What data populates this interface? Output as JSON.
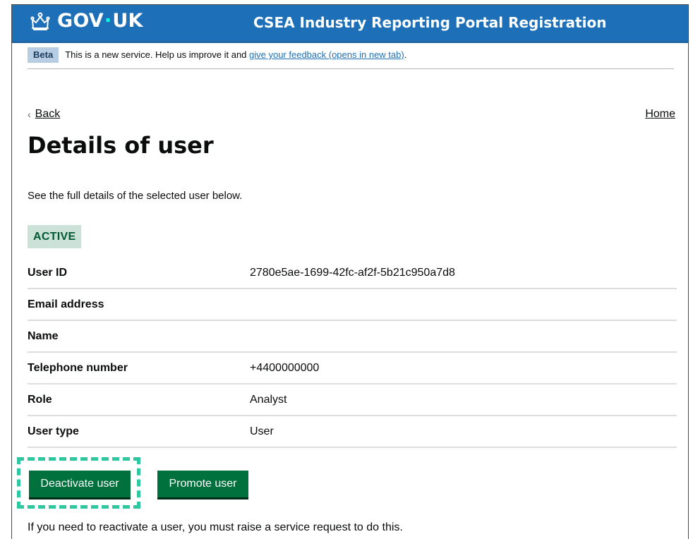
{
  "header": {
    "logo_text_left": "GOV",
    "logo_dot": "·",
    "logo_text_right": "UK",
    "logo_icon": "crown-icon",
    "service_name": "CSEA Industry Reporting Portal Registration",
    "header_color": "#1d70b8"
  },
  "phase_banner": {
    "tag": "Beta",
    "text": "This is a new service. Help us improve it and ",
    "link": "give your feedback (opens in new tab)",
    "suffix": "."
  },
  "nav": {
    "back_label": "Back",
    "back_icon": "chevron-left-icon",
    "home_label": "Home"
  },
  "page": {
    "title": "Details of user",
    "lead": "See the full details of the selected user below.",
    "status": "ACTIVE"
  },
  "summary": [
    {
      "key": "User ID",
      "value": "2780e5ae-1699-42fc-af2f-5b21c950a7d8"
    },
    {
      "key": "Email address",
      "value": ""
    },
    {
      "key": "Name",
      "value": ""
    },
    {
      "key": "Telephone number",
      "value": "+4400000000"
    },
    {
      "key": "Role",
      "value": "Analyst"
    },
    {
      "key": "User type",
      "value": "User"
    }
  ],
  "actions": {
    "deactivate_label": "Deactivate user",
    "promote_label": "Promote user",
    "button_color": "#00703c",
    "highlight_color": "#2ec79f"
  },
  "footnote": "If you need to reactivate a user, you must raise a service request to do this."
}
